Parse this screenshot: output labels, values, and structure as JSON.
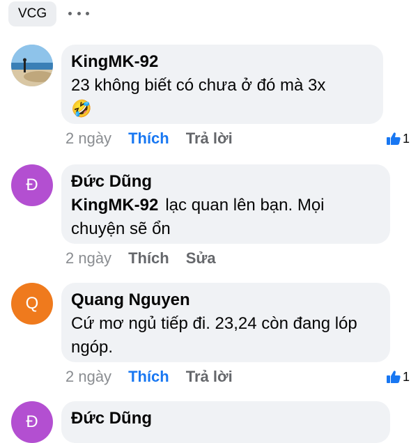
{
  "header": {
    "group_chip": "VCG",
    "more_icon": "more-horizontal-icon"
  },
  "colors": {
    "link_blue": "#1877f2",
    "avatar_duc_dung": "#b34fd1",
    "avatar_quang_nguyen": "#ef7a1d",
    "bubble_bg": "#f0f2f5",
    "muted_text": "#65676b"
  },
  "comments": [
    {
      "author": "KingMK-92",
      "text": "23 không biết có chưa ở đó mà 3x",
      "emoji": "🤣",
      "time": "2 ngày",
      "actions": [
        "Thích",
        "Trả lời"
      ],
      "like_active": true,
      "reaction_count": "1",
      "avatar": "photo"
    },
    {
      "author": "Đức Dũng",
      "mention": "KingMK-92",
      "text": "lạc quan lên bạn. Mọi chuyện sẽ ổn",
      "time": "2 ngày",
      "actions": [
        "Thích",
        "Sửa"
      ],
      "like_active": false,
      "avatar": "Đ"
    },
    {
      "author": "Quang Nguyen",
      "text": "Cứ mơ ngủ tiếp đi. 23,24 còn đang lóp ngóp.",
      "time": "2 ngày",
      "actions": [
        "Thích",
        "Trả lời"
      ],
      "like_active": true,
      "reaction_count": "1",
      "avatar": "Q"
    },
    {
      "author": "Đức Dũng",
      "avatar": "Đ"
    }
  ]
}
